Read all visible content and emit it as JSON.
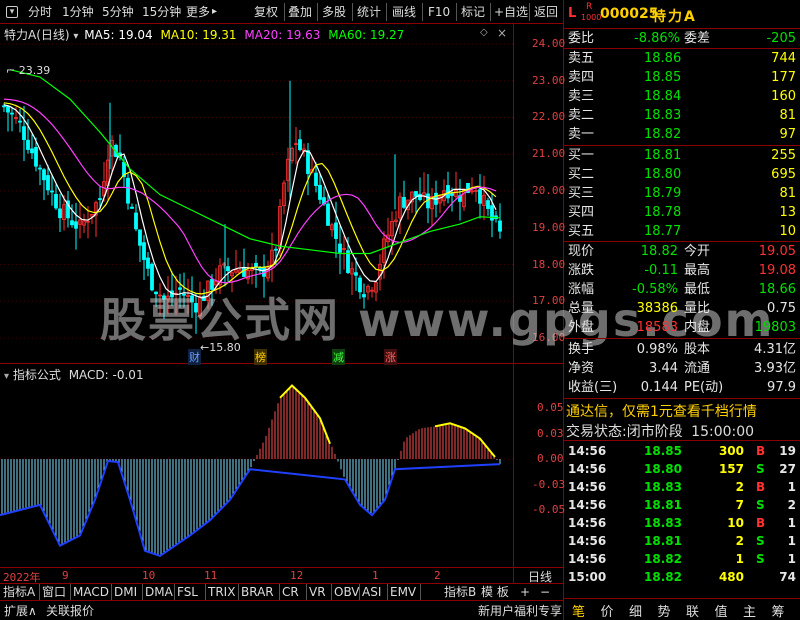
{
  "toolbar": {
    "items": [
      "分时",
      "1分钟",
      "5分钟",
      "15分钟",
      "更多"
    ],
    "more_arrow": "▸",
    "right_items": [
      "复权",
      "叠加",
      "多股",
      "统计",
      "画线",
      "F10",
      "标记",
      "+自选",
      "返回"
    ]
  },
  "chart": {
    "stock_title": "特力A(日线)",
    "ma5": "MA5: 19.04",
    "ma10": "MA10: 19.31",
    "ma20": "MA20: 19.63",
    "ma60": "MA60: 19.27",
    "high_label": "23.39",
    "low_label": "15.80",
    "markers": [
      "财",
      "榜",
      "减",
      "涨"
    ],
    "y_ticks": [
      "24.00",
      "23.00",
      "22.00",
      "21.00",
      "20.00",
      "19.00",
      "18.00",
      "17.00",
      "16.00"
    ],
    "macd_title": "指标公式",
    "macd_value": "MACD: -0.01",
    "macd_ticks": [
      "0.05",
      "0.03",
      "0.00",
      "-0.03",
      "-0.05"
    ],
    "date_labels": [
      "2022年",
      "9",
      "10",
      "11",
      "12",
      "1",
      "2"
    ],
    "period_label": "日线",
    "watermark": "股票公式网 www.gpgs.com",
    "colors": {
      "ma5": "#ffffff",
      "ma10": "#ffff00",
      "ma20": "#ff40ff",
      "ma60": "#00ff00",
      "up": "#ff3030",
      "down": "#00ffff"
    }
  },
  "bottom_tabs": [
    "指标A",
    "窗口",
    "MACD",
    "DMI",
    "DMA",
    "FSL",
    "TRIX",
    "BRAR",
    "CR",
    "VR",
    "OBV",
    "ASI",
    "EMV"
  ],
  "bottom_tabs2": [
    "指标B",
    "模 板",
    "+",
    "−"
  ],
  "footer": {
    "expand": "扩展∧",
    "related": "关联报价",
    "promo": "新用户福利专享"
  },
  "quote": {
    "l_label": "L",
    "r_label": "R",
    "level": "1000",
    "code": "000025",
    "name": "特力A",
    "weibi_label": "委比",
    "weibi": "-8.86%",
    "weicha_label": "委差",
    "weicha": "-205",
    "sells": [
      {
        "label": "卖五",
        "price": "18.86",
        "vol": "744"
      },
      {
        "label": "卖四",
        "price": "18.85",
        "vol": "177"
      },
      {
        "label": "卖三",
        "price": "18.84",
        "vol": "160"
      },
      {
        "label": "卖二",
        "price": "18.83",
        "vol": "81"
      },
      {
        "label": "卖一",
        "price": "18.82",
        "vol": "97"
      }
    ],
    "buys": [
      {
        "label": "买一",
        "price": "18.81",
        "vol": "255"
      },
      {
        "label": "买二",
        "price": "18.80",
        "vol": "695"
      },
      {
        "label": "买三",
        "price": "18.79",
        "vol": "81"
      },
      {
        "label": "买四",
        "price": "18.78",
        "vol": "13"
      },
      {
        "label": "买五",
        "price": "18.77",
        "vol": "10"
      }
    ],
    "stats": [
      {
        "l1": "现价",
        "v1": "18.82",
        "l2": "今开",
        "v2": "19.05"
      },
      {
        "l1": "涨跌",
        "v1": "-0.11",
        "l2": "最高",
        "v2": "19.08"
      },
      {
        "l1": "涨幅",
        "v1": "-0.58%",
        "l2": "最低",
        "v2": "18.66"
      },
      {
        "l1": "总量",
        "v1": "38386",
        "l2": "量比",
        "v2": "0.75"
      },
      {
        "l1": "外盘",
        "v1": "18583",
        "l2": "内盘",
        "v2": "19803"
      }
    ],
    "stats2": [
      {
        "l1": "换手",
        "v1": "0.98%",
        "l2": "股本",
        "v2": "4.31亿"
      },
      {
        "l1": "净资",
        "v1": "3.44",
        "l2": "流通",
        "v2": "3.93亿"
      },
      {
        "l1": "收益(三)",
        "v1": "0.144",
        "l2": "PE(动)",
        "v2": "97.9"
      }
    ],
    "ad": "通达信，仅需1元查看千档行情",
    "trade_status_label": "交易状态:",
    "trade_status": "闭市阶段",
    "trade_time": "15:00:00",
    "ticks": [
      {
        "t": "14:56",
        "p": "18.85",
        "v": "300",
        "d": "B",
        "n": "19"
      },
      {
        "t": "14:56",
        "p": "18.80",
        "v": "157",
        "d": "S",
        "n": "27"
      },
      {
        "t": "14:56",
        "p": "18.83",
        "v": "2",
        "d": "B",
        "n": "1"
      },
      {
        "t": "14:56",
        "p": "18.81",
        "v": "7",
        "d": "S",
        "n": "2"
      },
      {
        "t": "14:56",
        "p": "18.83",
        "v": "10",
        "d": "B",
        "n": "1"
      },
      {
        "t": "14:56",
        "p": "18.81",
        "v": "2",
        "d": "S",
        "n": "1"
      },
      {
        "t": "14:56",
        "p": "18.82",
        "v": "1",
        "d": "S",
        "n": "1"
      },
      {
        "t": "15:00",
        "p": "18.82",
        "v": "480",
        "d": "",
        "n": "74"
      }
    ],
    "bottom_tabs": [
      "笔",
      "价",
      "细",
      "势",
      "联",
      "值",
      "主",
      "筹"
    ]
  }
}
